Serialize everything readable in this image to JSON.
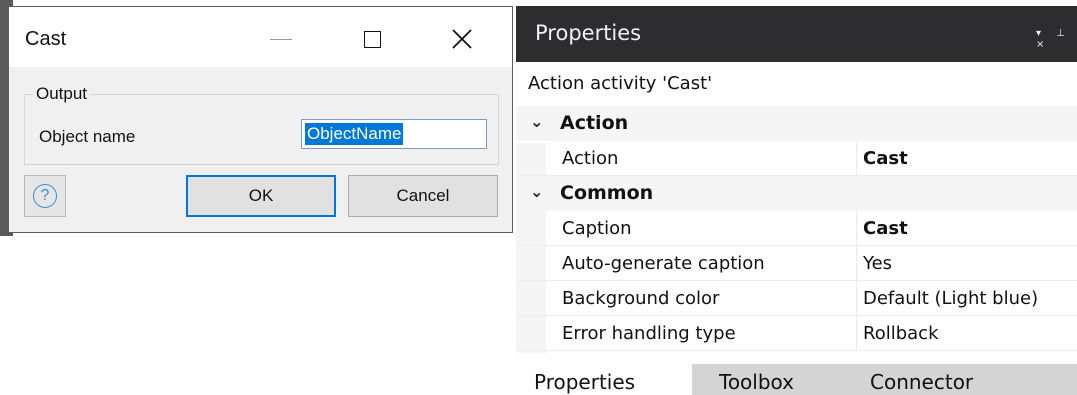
{
  "dialog": {
    "title": "Cast",
    "group_label": "Output",
    "field_label": "Object name",
    "field_value": "ObjectName",
    "help_glyph": "?",
    "ok_label": "OK",
    "cancel_label": "Cancel"
  },
  "properties": {
    "title": "Properties",
    "tools": "▾ ⊥ ×",
    "activity": "Action activity 'Cast'",
    "categories": [
      {
        "name": "Action",
        "rows": [
          {
            "key": "Action",
            "value": "Cast",
            "bold": true
          }
        ]
      },
      {
        "name": "Common",
        "rows": [
          {
            "key": "Caption",
            "value": "Cast",
            "bold": true
          },
          {
            "key": "Auto-generate caption",
            "value": "Yes",
            "bold": false
          },
          {
            "key": "Background color",
            "value": "Default (Light blue)",
            "bold": false
          },
          {
            "key": "Error handling type",
            "value": "Rollback",
            "bold": false
          }
        ]
      }
    ],
    "tabs": [
      "Properties",
      "Toolbox",
      "Connector"
    ]
  },
  "colors": {
    "panel_header": "#2d2d30",
    "selection": "#0078d7",
    "ok_border": "#0078d7"
  }
}
